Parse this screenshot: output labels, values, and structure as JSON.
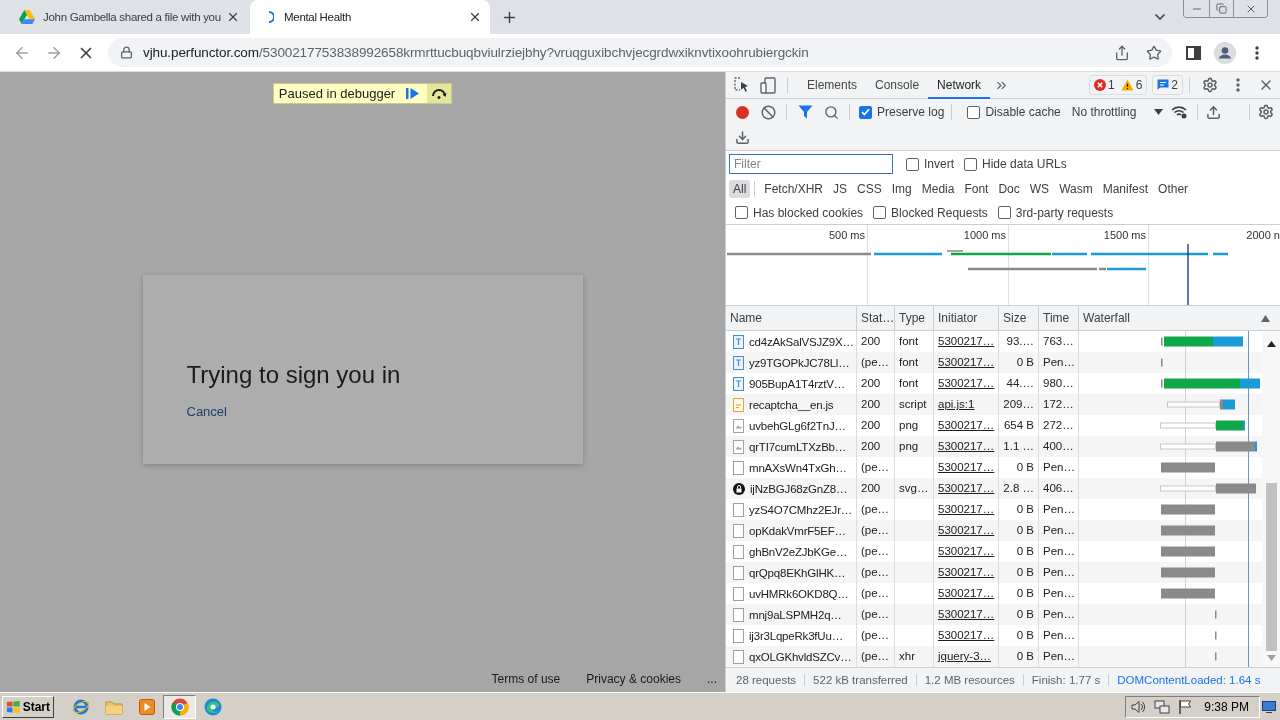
{
  "browser": {
    "tabs": [
      {
        "title": "John Gambella shared a file with you",
        "selected": false,
        "kind": "drive"
      },
      {
        "title": "Mental Health",
        "selected": true,
        "kind": "loading"
      }
    ],
    "address": {
      "host": "vjhu.perfunctor.com",
      "path": "/5300217753838992658krmrttucbuqbviulrziejbhy?vruqguxibchvjecgrdwxiknvtixoohrubiergckin"
    }
  },
  "page": {
    "debugger_banner": "Paused in debugger",
    "dialog": {
      "title": "Trying to sign you in",
      "cancel_link": "Cancel"
    },
    "footer_links": [
      "Terms of use",
      "Privacy & cookies",
      "..."
    ]
  },
  "devtools": {
    "tabs": [
      {
        "label": "Elements",
        "selected": false
      },
      {
        "label": "Console",
        "selected": false
      },
      {
        "label": "Network",
        "selected": true
      }
    ],
    "issues": {
      "errors": "1",
      "warnings": "6",
      "messages": "2"
    },
    "toolbar": {
      "recording": true,
      "options": [
        {
          "label": "Preserve log",
          "checked": true
        },
        {
          "label": "Disable cache",
          "checked": false
        }
      ],
      "throttling": "No throttling"
    },
    "filter": {
      "placeholder": "Filter",
      "options": [
        {
          "label": "Invert",
          "checked": false
        },
        {
          "label": "Hide data URLs",
          "checked": false
        }
      ]
    },
    "type_filters": [
      {
        "label": "All",
        "selected": true
      },
      {
        "label": "Fetch/XHR",
        "selected": false
      },
      {
        "label": "JS",
        "selected": false
      },
      {
        "label": "CSS",
        "selected": false
      },
      {
        "label": "Img",
        "selected": false
      },
      {
        "label": "Media",
        "selected": false
      },
      {
        "label": "Font",
        "selected": false
      },
      {
        "label": "Doc",
        "selected": false
      },
      {
        "label": "WS",
        "selected": false
      },
      {
        "label": "Wasm",
        "selected": false
      },
      {
        "label": "Manifest",
        "selected": false
      },
      {
        "label": "Other",
        "selected": false
      }
    ],
    "request_options": [
      {
        "label": "Has blocked cookies",
        "checked": false
      },
      {
        "label": "Blocked Requests",
        "checked": false
      },
      {
        "label": "3rd-party requests",
        "checked": false
      }
    ],
    "overview": {
      "ticks": [
        "500 ms",
        "1000 ms",
        "1500 ms",
        "2000 n"
      ]
    },
    "table": {
      "columns": [
        "Name",
        "Stat…",
        "Type",
        "Initiator",
        "Size",
        "Time",
        "Waterfall"
      ],
      "rows": [
        {
          "kind": "font",
          "name": "cd4zAkSalVSJZ9X…",
          "status": "200",
          "type": "font",
          "initiator": "5300217…",
          "size": "93.…",
          "time": "763…"
        },
        {
          "kind": "font",
          "name": "yz9TGOPkJC78Ll…",
          "status": "(pe…",
          "type": "font",
          "initiator": "5300217…",
          "size": "0 B",
          "time": "Pen…"
        },
        {
          "kind": "font",
          "name": "905BupA1T4rztV…",
          "status": "200",
          "type": "font",
          "initiator": "5300217…",
          "size": "44.…",
          "time": "980…"
        },
        {
          "kind": "script",
          "name": "recaptcha__en.js",
          "status": "200",
          "type": "script",
          "initiator": "api.js:1",
          "size": "209…",
          "time": "172…"
        },
        {
          "kind": "image",
          "name": "uvbehGLg6f2TnJ…",
          "status": "200",
          "type": "png",
          "initiator": "5300217…",
          "size": "654 B",
          "time": "272…"
        },
        {
          "kind": "image",
          "name": "qrTI7cumLTXzBb…",
          "status": "200",
          "type": "png",
          "initiator": "5300217…",
          "size": "1.1 …",
          "time": "400…"
        },
        {
          "kind": "other",
          "name": "mnAXsWn4TxGh…",
          "status": "(pe…",
          "initiator": "5300217…",
          "size": "0 B",
          "time": "Pen…"
        },
        {
          "kind": "favicon",
          "name": "ijNzBGJ68zGnZ8…",
          "status": "200",
          "type": "svg…",
          "initiator": "5300217…",
          "size": "2.8 …",
          "time": "406…"
        },
        {
          "kind": "other",
          "name": "yzS4O7CMhz2EJr…",
          "status": "(pe…",
          "initiator": "5300217…",
          "size": "0 B",
          "time": "Pen…"
        },
        {
          "kind": "other",
          "name": "opKdakVmrF5EF…",
          "status": "(pe…",
          "initiator": "5300217…",
          "size": "0 B",
          "time": "Pen…"
        },
        {
          "kind": "other",
          "name": "ghBnV2eZJbKGe…",
          "status": "(pe…",
          "initiator": "5300217…",
          "size": "0 B",
          "time": "Pen…"
        },
        {
          "kind": "other",
          "name": "qrQpq8EKhGlHK…",
          "status": "(pe…",
          "initiator": "5300217…",
          "size": "0 B",
          "time": "Pen…"
        },
        {
          "kind": "other",
          "name": "uvHMRk6OKD8Q…",
          "status": "(pe…",
          "initiator": "5300217…",
          "size": "0 B",
          "time": "Pen…"
        },
        {
          "kind": "other",
          "name": "mnj9aLSPMH2q…",
          "status": "(pe…",
          "initiator": "5300217…",
          "size": "0 B",
          "time": "Pen…"
        },
        {
          "kind": "other",
          "name": "ij3r3LqpeRk3fUu…",
          "status": "(pe…",
          "initiator": "5300217…",
          "size": "0 B",
          "time": "Pen…"
        },
        {
          "kind": "other",
          "name": "qxOLGKhvldSZCv…",
          "status": "(pe…",
          "type": "xhr",
          "initiator": "jquery-3…",
          "size": "0 B",
          "time": "Pen…"
        }
      ]
    },
    "summary": [
      "28 requests",
      "522 kB transferred",
      "1.2 MB resources",
      "Finish: 1.77 s"
    ],
    "dom_content_loaded": "DOMContentLoaded: 1.64 s"
  },
  "taskbar": {
    "start": "Start",
    "apps": [
      {
        "kind": "ie",
        "selected": false
      },
      {
        "kind": "folder",
        "selected": false
      },
      {
        "kind": "media",
        "selected": false
      },
      {
        "kind": "chrome",
        "selected": true
      },
      {
        "kind": "edge",
        "selected": false
      }
    ],
    "clock": "9:38 PM"
  }
}
